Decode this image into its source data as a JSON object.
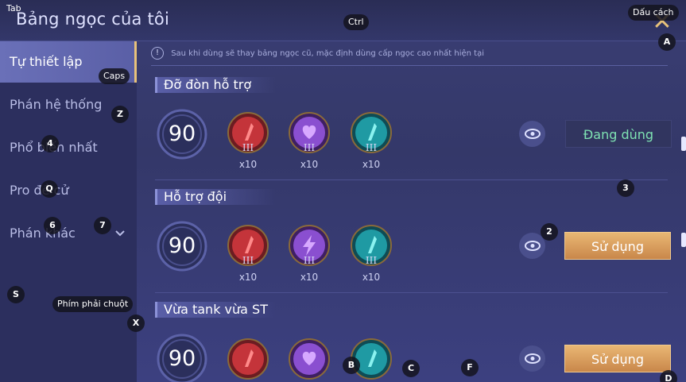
{
  "header": {
    "title": "Bảng ngọc của tôi",
    "close_icon": "close-icon"
  },
  "sidebar": {
    "items": [
      {
        "label": "Tự thiết lập",
        "active": true
      },
      {
        "label": "Phán hệ thống",
        "active": false
      },
      {
        "label": "Phổ biến nhất",
        "active": false
      },
      {
        "label": "Pro đề cử",
        "active": false
      },
      {
        "label": "Phán khác",
        "active": false,
        "has_chevron": true
      }
    ]
  },
  "notice": {
    "icon": "!",
    "text": "Sau khi dùng sẽ thay bảng ngọc cũ, mặc định dùng cấp ngọc cao nhất hiện tại"
  },
  "rune_pages": [
    {
      "name": "Đỡ đòn hỗ trợ",
      "level": "90",
      "gems": [
        {
          "color": "red",
          "tier": "III",
          "count": "x10",
          "icon": "red-gem-icon"
        },
        {
          "color": "purple",
          "tier": "III",
          "count": "x10",
          "icon": "purple-heart-gem-icon"
        },
        {
          "color": "teal",
          "tier": "III",
          "count": "x10",
          "icon": "teal-gem-icon"
        }
      ],
      "button_label": "Đang dùng",
      "in_use": true
    },
    {
      "name": "Hỗ trợ đội",
      "level": "90",
      "gems": [
        {
          "color": "red",
          "tier": "III",
          "count": "x10",
          "icon": "red-gem-icon"
        },
        {
          "color": "purple",
          "tier": "III",
          "count": "x10",
          "icon": "purple-lightning-gem-icon"
        },
        {
          "color": "teal",
          "tier": "III",
          "count": "x10",
          "icon": "teal-gem-icon"
        }
      ],
      "button_label": "Sử dụng",
      "in_use": false
    },
    {
      "name": "Vừa tank vừa ST",
      "level": "90",
      "gems": [
        {
          "color": "red",
          "tier": "",
          "count": "",
          "icon": "red-gem-icon"
        },
        {
          "color": "purple",
          "tier": "",
          "count": "",
          "icon": "purple-heart-gem-icon"
        },
        {
          "color": "teal",
          "tier": "",
          "count": "",
          "icon": "teal-gem-icon"
        }
      ],
      "button_label": "Sử dụng",
      "in_use": false
    }
  ],
  "key_hints": {
    "tab": "Tab",
    "ctrl": "Ctrl",
    "space": "Dấu cách",
    "a": "A",
    "caps": "Caps",
    "z": "Z",
    "k4": "4",
    "q": "Q",
    "k6": "6",
    "k7": "7",
    "k3": "3",
    "k2": "2",
    "s": "S",
    "rmb": "Phím phải chuột",
    "x": "X",
    "b": "B",
    "c": "C",
    "f": "F",
    "d": "D"
  },
  "colors": {
    "accent_gold": "#e8c27a",
    "in_use_text": "#7fe3b3",
    "gem_red": "#c4343a",
    "gem_purple": "#8a4fd0",
    "gem_teal": "#1f9aa3"
  }
}
